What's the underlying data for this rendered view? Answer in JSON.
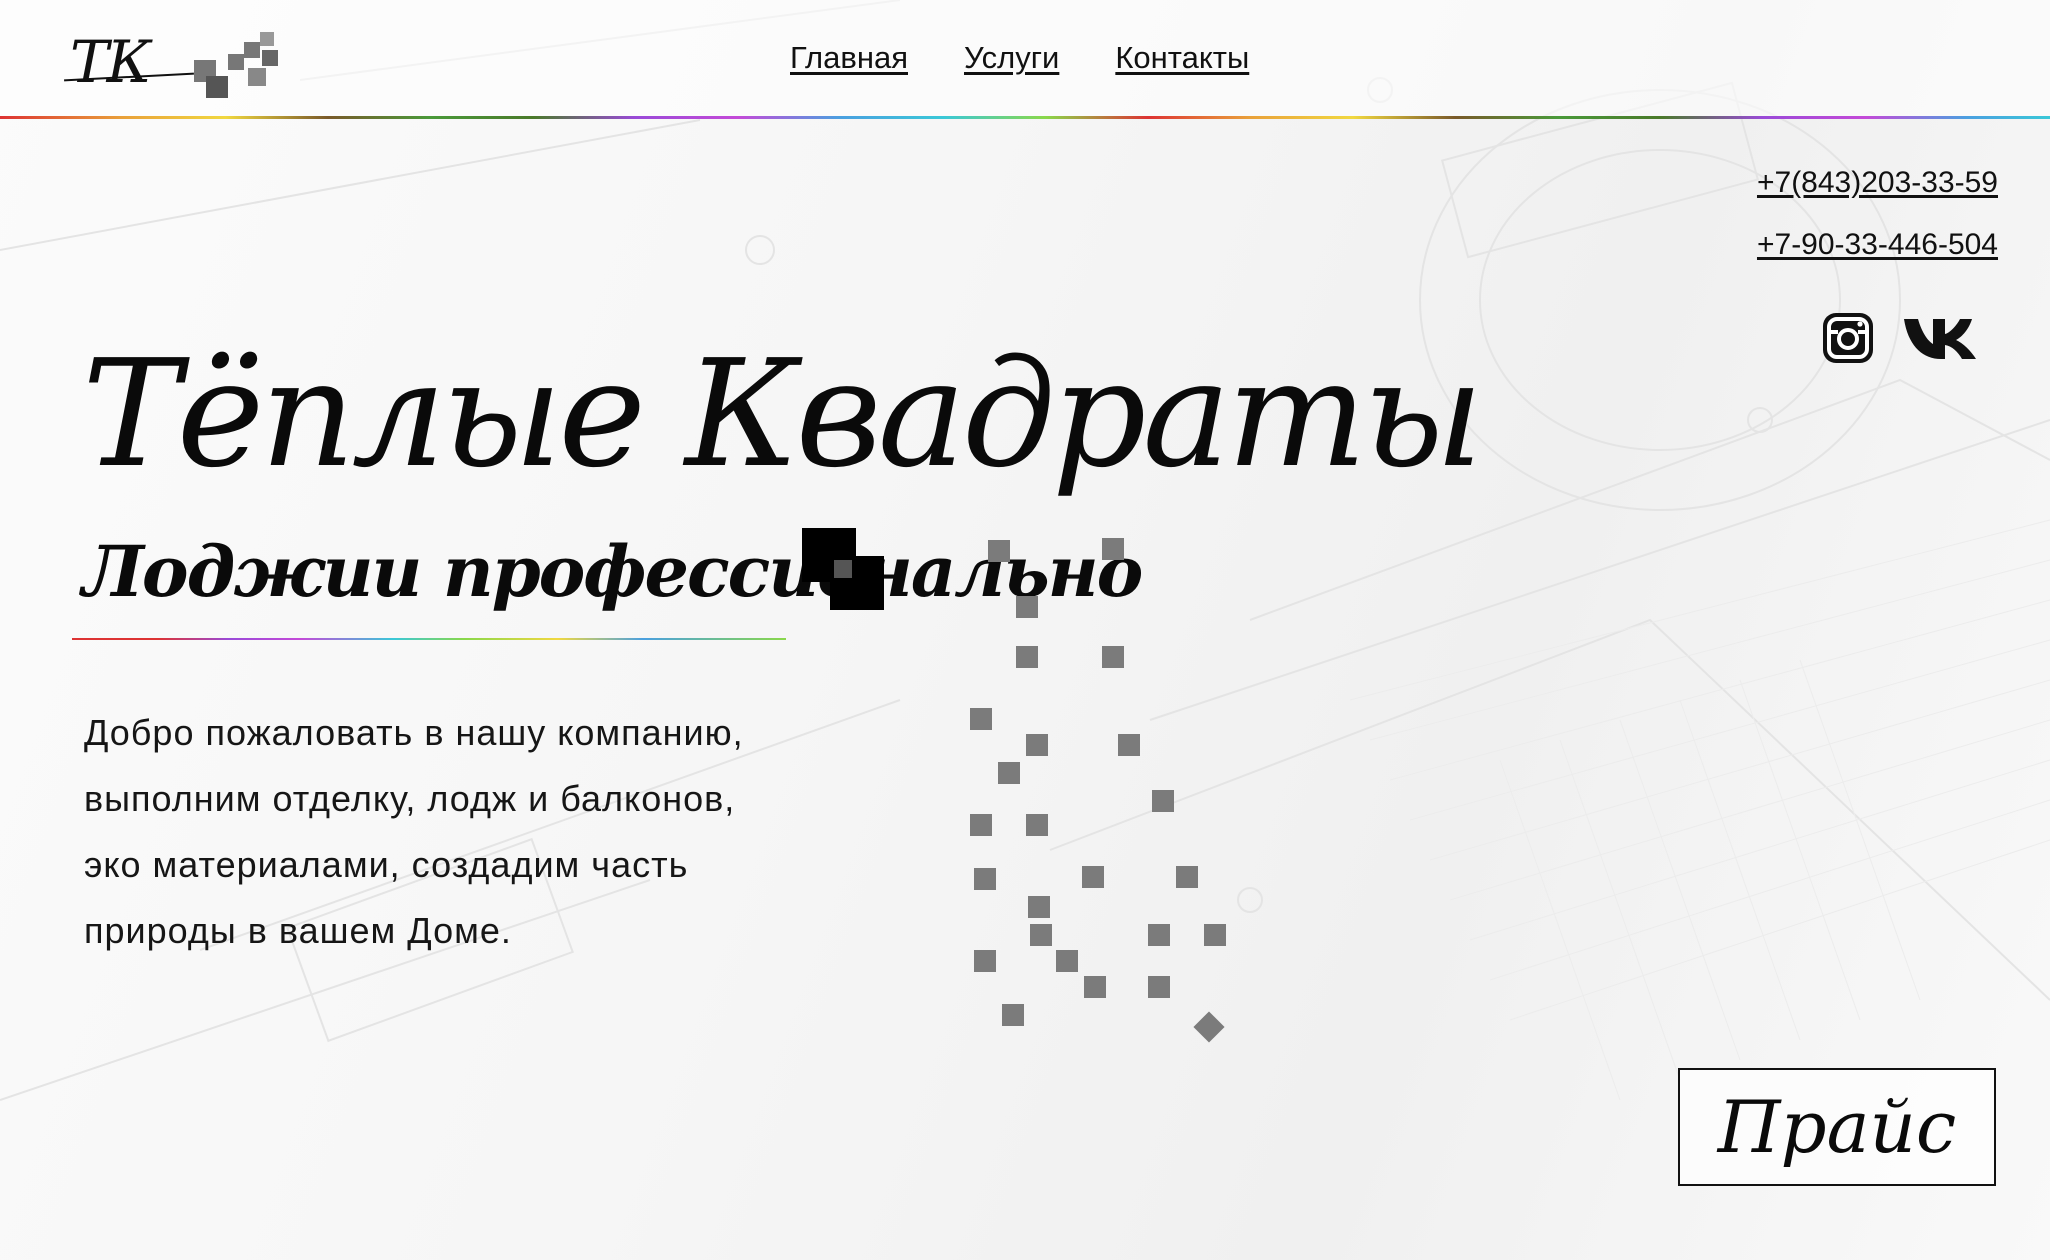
{
  "logo": {
    "text": "ТК",
    "icon": "pixel-squares-logo"
  },
  "nav": {
    "items": [
      {
        "label": "Главная"
      },
      {
        "label": "Услуги"
      },
      {
        "label": "Контакты"
      }
    ]
  },
  "contacts": {
    "phones": [
      "+7(843)203-33-59",
      "+7-90-33-446-504"
    ],
    "socials": [
      {
        "icon": "instagram-icon"
      },
      {
        "icon": "vk-icon"
      }
    ]
  },
  "hero": {
    "title": "Тёплые Квадраты",
    "subtitle": "Лоджии профессионально",
    "intro_lines": [
      "Добро пожаловать в нашу компанию,",
      "выполним отделку, лодж и балконов,",
      "эко материалами, создадим часть",
      "природы в вашем Доме."
    ]
  },
  "price_button": {
    "label": "Прайс"
  },
  "colors": {
    "text": "#111111",
    "square_gray": "#7b7b7b",
    "square_black": "#000000",
    "background": "#f7f7f7"
  }
}
